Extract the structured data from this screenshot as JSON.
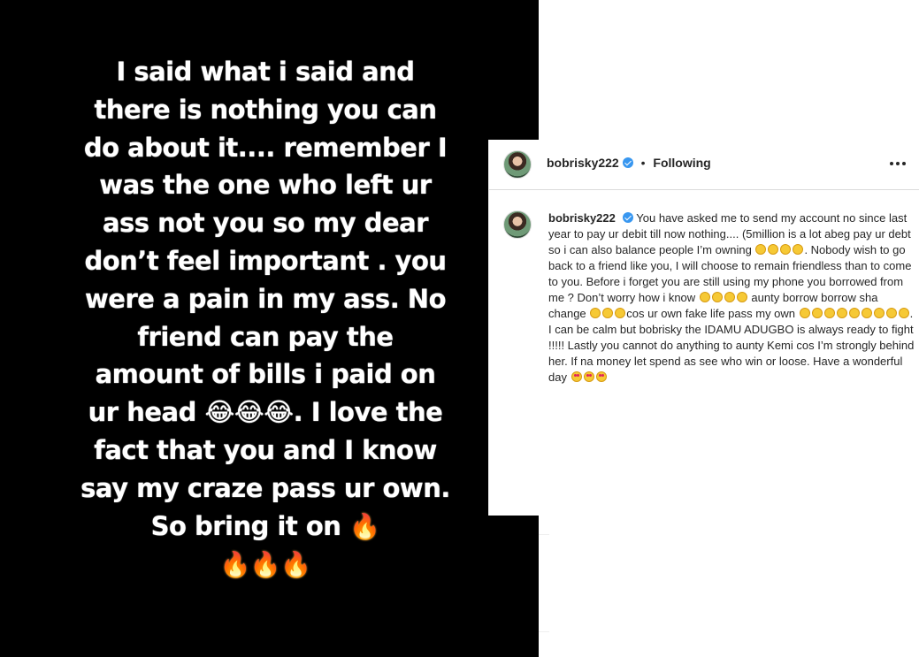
{
  "story": {
    "text": "I said what i said and there is nothing you can do about it.... remember I was the one who left ur ass not you so my dear don’t feel important . you were a pain in my ass. No friend can pay the amount of bills i paid on ur head",
    "text_after_emoji": ". I love the fact that you and I know say my craze pass ur own. So bring it on",
    "laugh_emoji": "😂😂😂",
    "fire_emoji_1": "🔥",
    "fire_emoji_2": "🔥🔥🔥"
  },
  "post": {
    "username": "bobrisky222",
    "following_label": "Following",
    "separator": "•",
    "caption_parts": [
      "You have asked me to send my account no since last year to pay ur debit till now nothing.... (5million is a lot abeg pay ur debt so i can also balance people I’m owning",
      ". Nobody wish to go back to a friend like you, I will choose to remain friendless than to come to you. Before i forget you are still using my phone you borrowed from me ? Don’t worry how i know",
      "aunty borrow borrow sha change",
      "cos ur own fake life pass my own",
      ". I can be calm but bobrisky the IDAMU ADUGBO is always ready to fight !!!!! Lastly you cannot do anything to aunty Kemi cos I’m strongly behind her. If na money let spend as see who win or loose. Have a wonderful day"
    ]
  },
  "colors": {
    "story_bg": "#000000",
    "story_text": "#ffffff",
    "verified": "#3897f0",
    "text": "#262626"
  },
  "icons": [
    "verified-badge-icon",
    "more-options-icon",
    "laughing-emoji-icon",
    "heart-eyes-emoji-icon",
    "fire-emoji-icon"
  ]
}
